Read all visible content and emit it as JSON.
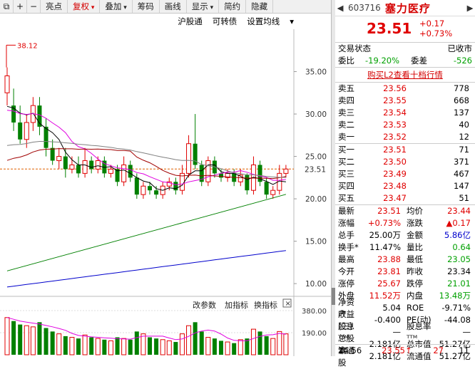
{
  "toolbar": {
    "items": [
      "亮点",
      "复权",
      "叠加",
      "筹码",
      "画线",
      "显示",
      "简约",
      "隐藏"
    ]
  },
  "subbar": {
    "items": [
      "沪股通",
      "可转债",
      "设置均线"
    ]
  },
  "chart": {
    "high_label": "38.12",
    "y_ticks": [
      "35.00",
      "30.00",
      "25.00",
      "20.00",
      "15.00",
      "10.00"
    ],
    "current_price": "23.51",
    "vol_ticks": [
      "380.00",
      "190.00"
    ],
    "vol_menu": [
      "改参数",
      "加指标",
      "换指标"
    ]
  },
  "chart_data": {
    "type": "candlestick",
    "ylim": [
      8.5,
      40
    ],
    "candles": [
      [
        32.5,
        34.5,
        31,
        35.5
      ],
      [
        31,
        29,
        28,
        33
      ],
      [
        29,
        27,
        26.5,
        31
      ],
      [
        27,
        29,
        26,
        30
      ],
      [
        29,
        31,
        28,
        32
      ],
      [
        31,
        28.5,
        27.5,
        32
      ],
      [
        28.5,
        26,
        25,
        29.5
      ],
      [
        26,
        24.5,
        24,
        27
      ],
      [
        24.5,
        25,
        23.5,
        26
      ],
      [
        25,
        23.5,
        22.5,
        26
      ],
      [
        23.5,
        24,
        23,
        25
      ],
      [
        24,
        23,
        22.5,
        25
      ],
      [
        23,
        24.5,
        22.5,
        26
      ],
      [
        24.5,
        23.5,
        23,
        25
      ],
      [
        23.5,
        24.5,
        23,
        25
      ],
      [
        24.5,
        23,
        22.5,
        25
      ],
      [
        23,
        23.5,
        22.5,
        24
      ],
      [
        23.5,
        22,
        21.5,
        24
      ],
      [
        22,
        24,
        21.5,
        25
      ],
      [
        24,
        22.5,
        22,
        24.5
      ],
      [
        22.5,
        20.5,
        20,
        23
      ],
      [
        20.5,
        21.5,
        20,
        22
      ],
      [
        21.5,
        21,
        20.5,
        22
      ],
      [
        21,
        20.5,
        20,
        21.5
      ],
      [
        20.5,
        21.5,
        20,
        22
      ],
      [
        21.5,
        22,
        21,
        22.5
      ],
      [
        22,
        21,
        20.5,
        22.5
      ],
      [
        21,
        23,
        20.5,
        24
      ],
      [
        23,
        26.5,
        22.5,
        27.5
      ],
      [
        26.5,
        24,
        23.5,
        30
      ],
      [
        24,
        22,
        21.5,
        24.5
      ],
      [
        22,
        24.5,
        21.5,
        25
      ],
      [
        24.5,
        23,
        22.5,
        25
      ],
      [
        23,
        22.5,
        22,
        23.5
      ],
      [
        22.5,
        23,
        22,
        23.5
      ],
      [
        23,
        22,
        21.5,
        23.5
      ],
      [
        22,
        22.8,
        21.5,
        23.5
      ],
      [
        22.8,
        21,
        20.5,
        23
      ],
      [
        21,
        24,
        20.5,
        25
      ],
      [
        24,
        22,
        21.5,
        24.5
      ],
      [
        22,
        20.5,
        20,
        22.5
      ],
      [
        20.5,
        21,
        20,
        21.5
      ],
      [
        21,
        23,
        20.5,
        24
      ],
      [
        23,
        23.51,
        22.5,
        24
      ]
    ],
    "volume": {
      "ylim": [
        0,
        380
      ],
      "values": [
        320,
        290,
        260,
        250,
        240,
        280,
        230,
        200,
        180,
        160,
        150,
        140,
        170,
        150,
        140,
        130,
        120,
        150,
        140,
        130,
        200,
        180,
        150,
        140,
        130,
        120,
        110,
        180,
        250,
        280,
        200,
        150,
        140,
        120,
        110,
        100,
        130,
        140,
        220,
        200,
        160,
        140,
        200,
        180
      ]
    },
    "ma_colors": [
      "#000000",
      "#e000e0",
      "#a00000",
      "#808080",
      "#008000",
      "#0000cc"
    ]
  },
  "panel": {
    "code": "603716",
    "name": "塞力医疗",
    "price": "23.51",
    "change": "+0.17",
    "change_pct": "+0.73%",
    "trade_status_label": "交易状态",
    "trade_status": "已收市",
    "weibi_label": "委比",
    "weibi": "-19.20%",
    "weicha_label": "委差",
    "weicha": "-526",
    "l2_link": "购买L2查看十档行情",
    "asks": [
      {
        "label": "卖五",
        "price": "23.56",
        "vol": "778"
      },
      {
        "label": "卖四",
        "price": "23.55",
        "vol": "668"
      },
      {
        "label": "卖三",
        "price": "23.54",
        "vol": "137"
      },
      {
        "label": "卖二",
        "price": "23.53",
        "vol": "40"
      },
      {
        "label": "卖一",
        "price": "23.52",
        "vol": "12"
      }
    ],
    "bids": [
      {
        "label": "买一",
        "price": "23.51",
        "vol": "71"
      },
      {
        "label": "买二",
        "price": "23.50",
        "vol": "371"
      },
      {
        "label": "买三",
        "price": "23.49",
        "vol": "467"
      },
      {
        "label": "买四",
        "price": "23.48",
        "vol": "147"
      },
      {
        "label": "买五",
        "price": "23.47",
        "vol": "51"
      }
    ],
    "quotes": [
      [
        "最新",
        "23.51",
        "r",
        "均价",
        "23.44",
        "r"
      ],
      [
        "涨幅",
        "+0.73%",
        "r",
        "涨跌",
        "▲0.17",
        "r"
      ],
      [
        "总手",
        "25.00万",
        "k",
        "金额",
        "5.86亿",
        "b"
      ],
      [
        "换手*",
        "11.47%",
        "k",
        "量比",
        "0.64",
        "g"
      ],
      [
        "最高",
        "23.88",
        "r",
        "最低",
        "23.05",
        "g"
      ],
      [
        "今开",
        "23.81",
        "r",
        "昨收",
        "23.34",
        "k"
      ],
      [
        "涨停",
        "25.67",
        "r",
        "跌停",
        "21.01",
        "g"
      ],
      [
        "外盘",
        "11.52万",
        "r",
        "内盘",
        "13.48万",
        "g"
      ],
      [
        "净资产",
        "5.04",
        "k",
        "ROE",
        "-9.71%",
        "k"
      ],
      [
        "收益(三)",
        "-0.400",
        "k",
        "PE(动)",
        "-44.08",
        "k"
      ],
      [
        "股息ᵀᵀᴹ",
        "—",
        "k",
        "股息率ᵀᵀᴹ",
        "—",
        "k"
      ],
      [
        "总股本",
        "2.181亿",
        "k",
        "总市值",
        "51.27亿",
        "k"
      ],
      [
        "流通股",
        "2.181亿",
        "k",
        "流通值",
        "51.27亿",
        "k"
      ]
    ],
    "footer": {
      "time": "14:56",
      "price": "23.55",
      "vol": "27",
      "count": "11"
    }
  }
}
